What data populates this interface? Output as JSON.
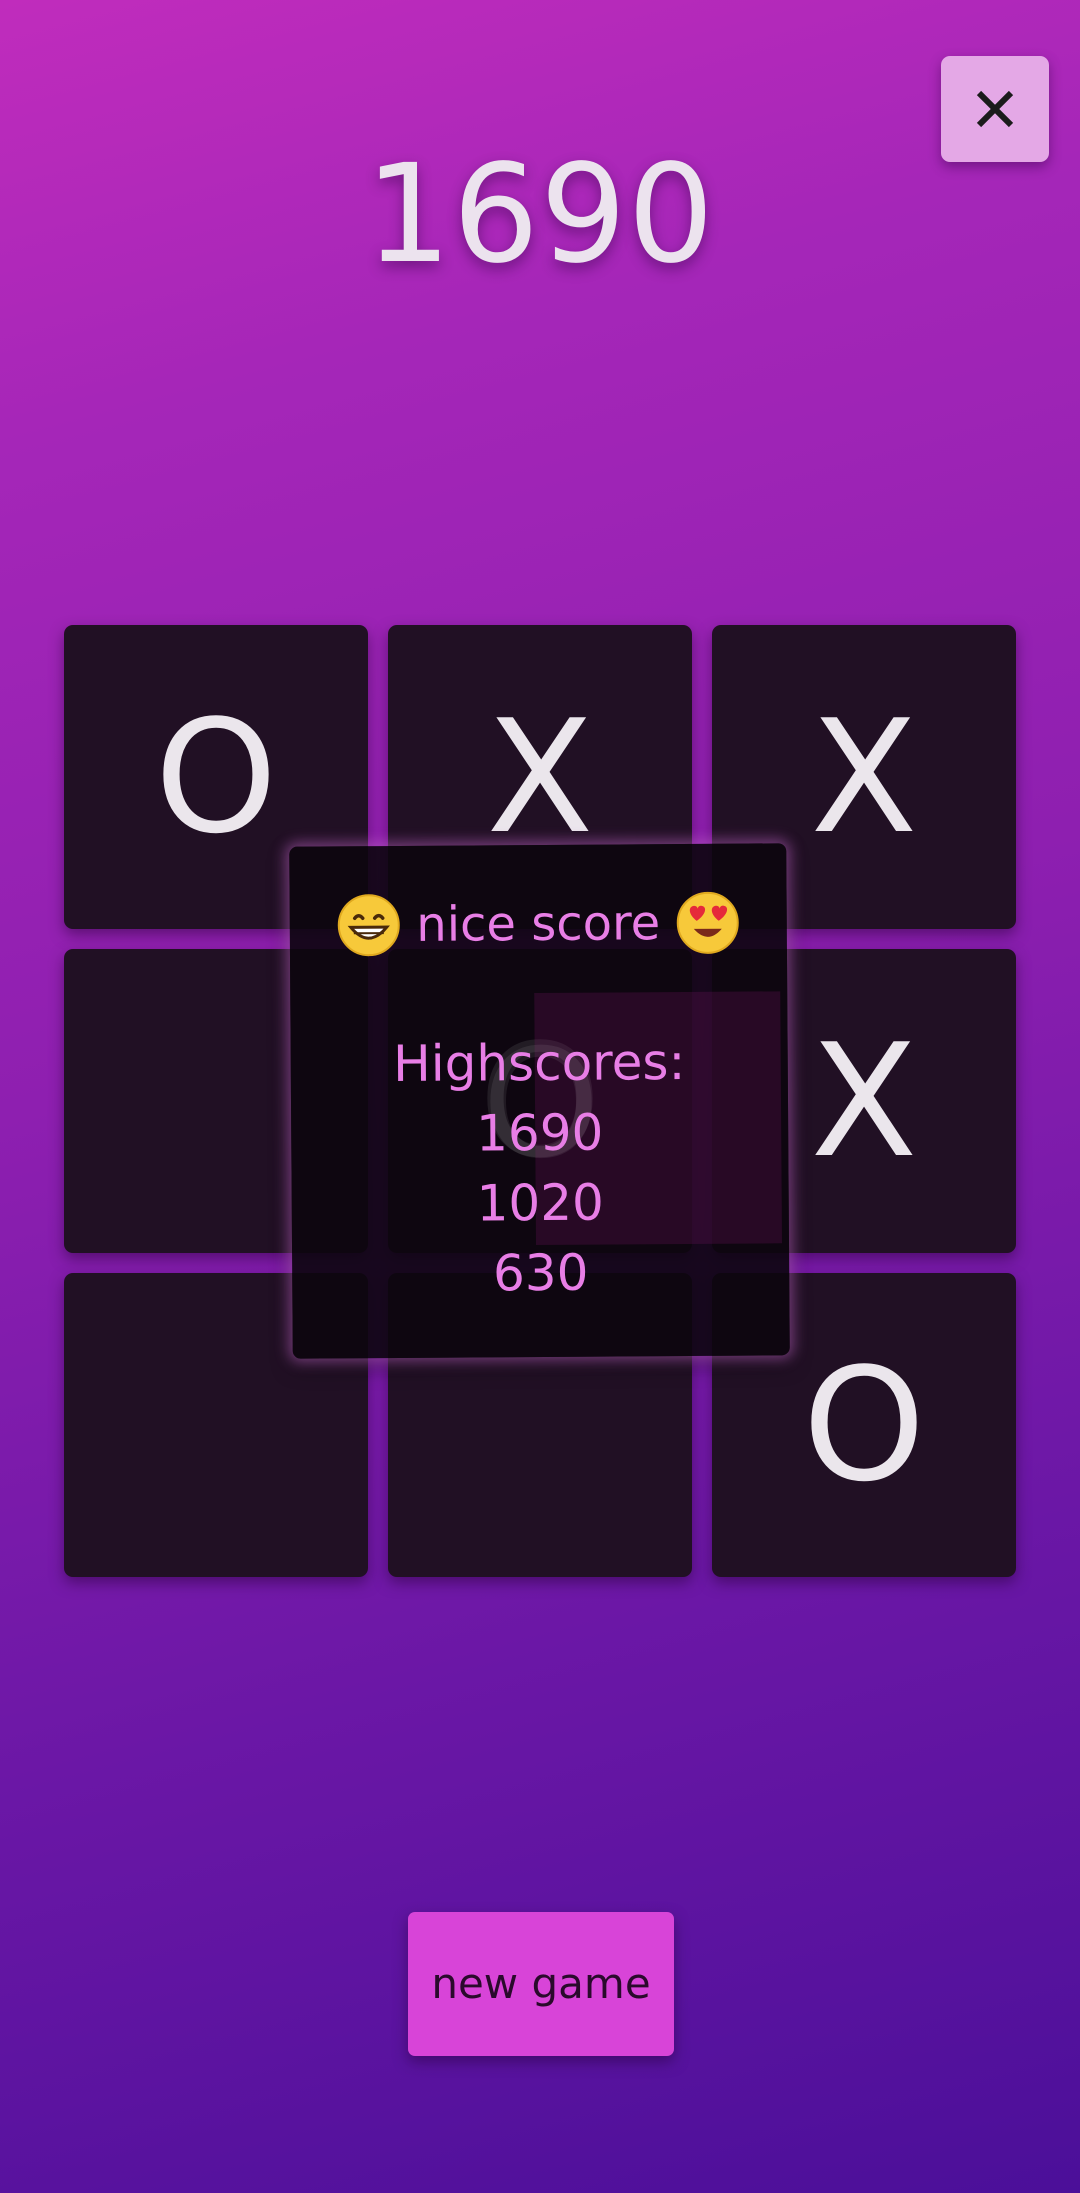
{
  "score": "1690",
  "close_button": {
    "icon": "close-icon"
  },
  "board": {
    "cells": [
      "O",
      "X",
      "X",
      "",
      "O",
      "X",
      "",
      "",
      "O"
    ]
  },
  "dialog": {
    "left_emoji": "grinning-face-emoji",
    "message": "nice score",
    "right_emoji": "heart-eyes-emoji",
    "highscores_label": "Highscores:",
    "highscores": [
      "1690",
      "1020",
      "630"
    ]
  },
  "new_game_label": "new game",
  "colors": {
    "background_top": "#c02cbc",
    "background_bottom": "#4b0f99",
    "cell": "#211024",
    "dialog_text": "#e87ee6",
    "new_game_button": "#d844d8",
    "close_button": "#e4a8e6"
  }
}
